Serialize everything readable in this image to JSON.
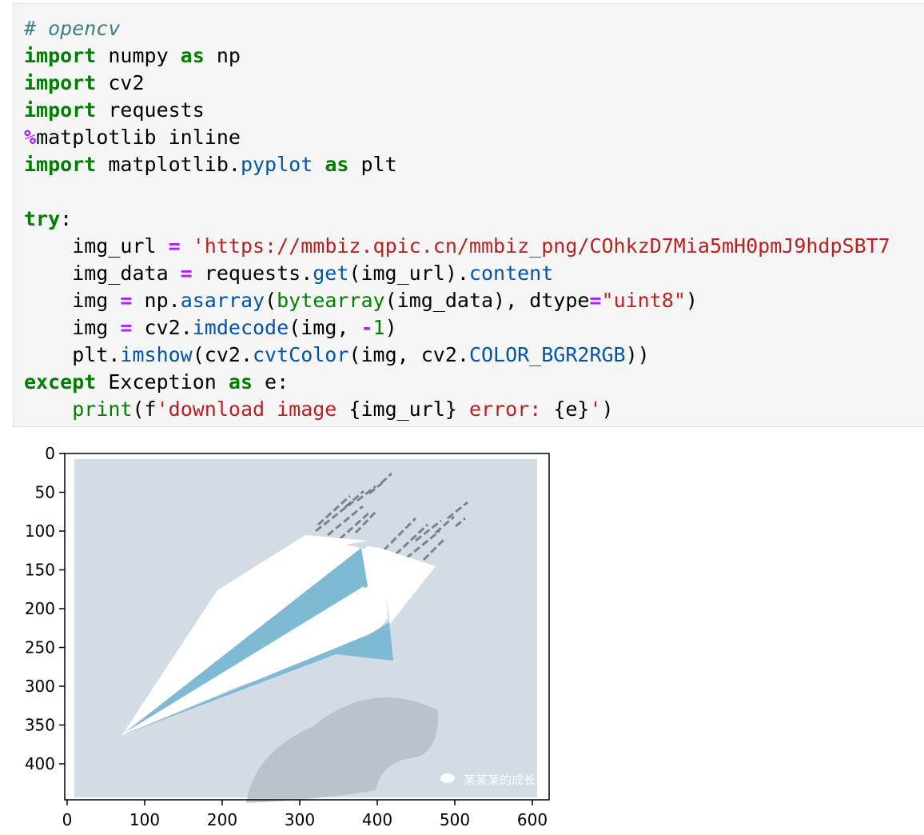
{
  "code_cell": {
    "lines": [
      [
        {
          "t": "# opencv",
          "c": "cm"
        }
      ],
      [
        {
          "t": "import",
          "c": "kw"
        },
        {
          "t": " numpy ",
          "c": ""
        },
        {
          "t": "as",
          "c": "kw"
        },
        {
          "t": " np",
          "c": ""
        }
      ],
      [
        {
          "t": "import",
          "c": "kw"
        },
        {
          "t": " cv2",
          "c": ""
        }
      ],
      [
        {
          "t": "import",
          "c": "kw"
        },
        {
          "t": " requests",
          "c": ""
        }
      ],
      [
        {
          "t": "%",
          "c": "mg"
        },
        {
          "t": "matplotlib inline",
          "c": ""
        }
      ],
      [
        {
          "t": "import",
          "c": "kw"
        },
        {
          "t": " matplotlib.",
          "c": ""
        },
        {
          "t": "pyplot",
          "c": "at"
        },
        {
          "t": " ",
          "c": ""
        },
        {
          "t": "as",
          "c": "kw"
        },
        {
          "t": " plt",
          "c": ""
        }
      ],
      [],
      [
        {
          "t": "try",
          "c": "kw"
        },
        {
          "t": ":",
          "c": ""
        }
      ],
      [
        {
          "t": "    img_url ",
          "c": ""
        },
        {
          "t": "=",
          "c": "mg"
        },
        {
          "t": " ",
          "c": ""
        },
        {
          "t": "'https://mmbiz.qpic.cn/mmbiz_png/COhkzD7Mia5mH0pmJ9hdpSBT7",
          "c": "str"
        }
      ],
      [
        {
          "t": "    img_data ",
          "c": ""
        },
        {
          "t": "=",
          "c": "mg"
        },
        {
          "t": " requests.",
          "c": ""
        },
        {
          "t": "get",
          "c": "at"
        },
        {
          "t": "(img_url).",
          "c": ""
        },
        {
          "t": "content",
          "c": "at"
        }
      ],
      [
        {
          "t": "    img ",
          "c": ""
        },
        {
          "t": "=",
          "c": "mg"
        },
        {
          "t": " np.",
          "c": ""
        },
        {
          "t": "asarray",
          "c": "at"
        },
        {
          "t": "(",
          "c": ""
        },
        {
          "t": "bytearray",
          "c": "bi"
        },
        {
          "t": "(img_data), dtype",
          "c": ""
        },
        {
          "t": "=",
          "c": "mg"
        },
        {
          "t": "\"uint8\"",
          "c": "str"
        },
        {
          "t": ")",
          "c": ""
        }
      ],
      [
        {
          "t": "    img ",
          "c": ""
        },
        {
          "t": "=",
          "c": "mg"
        },
        {
          "t": " cv2.",
          "c": ""
        },
        {
          "t": "imdecode",
          "c": "at"
        },
        {
          "t": "(img, ",
          "c": ""
        },
        {
          "t": "-",
          "c": "mg"
        },
        {
          "t": "1",
          "c": "num"
        },
        {
          "t": ")",
          "c": ""
        }
      ],
      [
        {
          "t": "    plt.",
          "c": ""
        },
        {
          "t": "imshow",
          "c": "at"
        },
        {
          "t": "(cv2.",
          "c": ""
        },
        {
          "t": "cvtColor",
          "c": "at"
        },
        {
          "t": "(img, cv2.",
          "c": ""
        },
        {
          "t": "COLOR_BGR2RGB",
          "c": "at"
        },
        {
          "t": "))",
          "c": ""
        }
      ],
      [
        {
          "t": "except",
          "c": "kw"
        },
        {
          "t": " Exception ",
          "c": ""
        },
        {
          "t": "as",
          "c": "kw"
        },
        {
          "t": " e:",
          "c": ""
        }
      ],
      [
        {
          "t": "    ",
          "c": ""
        },
        {
          "t": "print",
          "c": "bi"
        },
        {
          "t": "(f",
          "c": ""
        },
        {
          "t": "'download image ",
          "c": "str"
        },
        {
          "t": "{img_url}",
          "c": ""
        },
        {
          "t": " error: ",
          "c": "str"
        },
        {
          "t": "{e}",
          "c": ""
        },
        {
          "t": "'",
          "c": "str"
        },
        {
          "t": ")",
          "c": ""
        }
      ]
    ]
  },
  "chart_data": {
    "type": "image",
    "x_ticks": [
      "0",
      "100",
      "200",
      "300",
      "400",
      "500",
      "600"
    ],
    "y_ticks": [
      "0",
      "50",
      "100",
      "150",
      "200",
      "250",
      "300",
      "350",
      "400"
    ],
    "xlim": [
      0,
      620
    ],
    "ylim": [
      0,
      445
    ]
  },
  "image": {
    "background_color": "#d3dce4",
    "watermark_text": "某某某的成长",
    "plane_color": "#ffffff",
    "fold_color": "#7fbad4",
    "shadow_color": "#b4bcc6"
  }
}
